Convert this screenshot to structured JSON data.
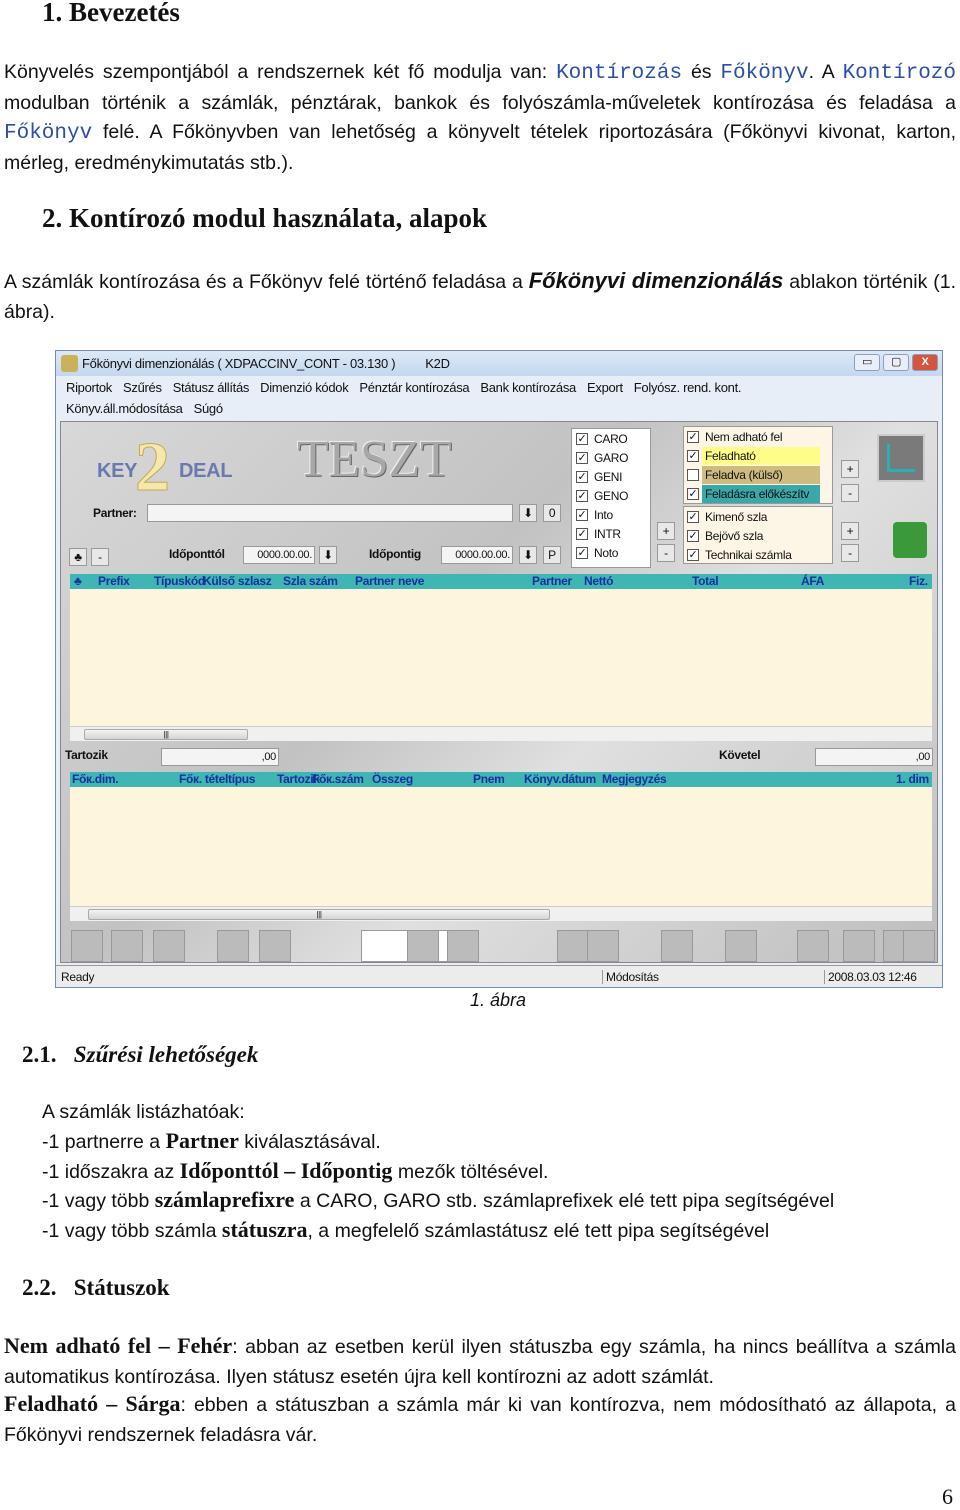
{
  "h1": "1.  Bevezetés",
  "p1": [
    "Könyvelés szempontjából a rendszernek két fő modulja van: ",
    "Kontírozás",
    " és ",
    "Főkönyv",
    ". A ",
    "Kontírozó",
    " modulban történik a számlák, pénztárak, bankok és folyószámla-műveletek kontírozása és feladása a ",
    "Főkönyv",
    " felé. A Főkönyvben van lehetőség a könyvelt tételek riportozására (Főkönyvi kivonat, karton, mérleg, eredménykimutatás stb.)."
  ],
  "h2": "2.  Kontírozó modul használata, alapok",
  "p2": [
    "A számlák kontírozása és a Főkönyv felé történő feladása a ",
    "Főkönyvi dimenzionálás",
    " ablakon történik (1. ábra)."
  ],
  "app": {
    "title": "Főkönyvi dimenzionálás ( XDPACCINV_CONT - 03.130 )",
    "title_suffix": "K2D",
    "window_buttons": [
      "▭",
      "▢",
      "X"
    ],
    "menu1": [
      "Riportok",
      "Szűrés",
      "Státusz állítás",
      "Dimenzió kódok",
      "Pénztár kontírozása",
      "Bank kontírozása",
      "Export",
      "Folyósz. rend. kont."
    ],
    "menu2": [
      "Könyv.áll.módosítása",
      "Súgó"
    ],
    "logo": "KEY2DEAL",
    "banner": "TESZT",
    "partner_label": "Partner:",
    "partner_value": "",
    "zero_btn": "0",
    "from_label": "Időponttól",
    "from_value": "0000.00.00.",
    "to_label": "Időpontig",
    "to_value": "0000.00.00.",
    "p_btn": "P",
    "prefixes": [
      {
        "label": "CARO",
        "checked": true
      },
      {
        "label": "GARO",
        "checked": true
      },
      {
        "label": "GENI",
        "checked": true
      },
      {
        "label": "GENO",
        "checked": true
      },
      {
        "label": "Into",
        "checked": true
      },
      {
        "label": "INTR",
        "checked": true
      },
      {
        "label": "Noto",
        "checked": true
      }
    ],
    "statuses": [
      {
        "label": "Nem adható fel",
        "checked": true,
        "color": "#fdf6e6"
      },
      {
        "label": "Feladható",
        "checked": true,
        "color": "#fdfd88"
      },
      {
        "label": "Feladva (külső)",
        "checked": false,
        "color": "#cdbb80"
      },
      {
        "label": "Feladásra előkészítv",
        "checked": true,
        "color": "#3aa8a8"
      }
    ],
    "types": [
      {
        "label": "Kimenő szla",
        "checked": true
      },
      {
        "label": "Bejövő szla",
        "checked": true
      },
      {
        "label": "Technikai számla",
        "checked": true
      }
    ],
    "grid1_cols": [
      "♣",
      "Prefix",
      "Típuskód",
      "Külső szlasz",
      "Szla szám",
      "Partner neve",
      "Partner",
      "Nettó",
      "Total",
      "ÁFA",
      "Fiz."
    ],
    "tartozik_label": "Tartozik",
    "tartozik_value": ",00",
    "kovetel_label": "Követel",
    "kovetel_value": ",00",
    "grid2_cols": [
      "Főк.dim.",
      "Főк. tételtípus",
      "Tartozik",
      "Főк.szám",
      "Összeg",
      "Pnem",
      "Könyv.dátum",
      "Megjegyzés",
      "1. dim"
    ],
    "status": {
      "left": "Ready",
      "mid": "Módosítás",
      "right": "2008.03.03 12:46"
    },
    "colors": {
      "grid_header": "#3fb6b4",
      "grid_body": "#fdf6dc",
      "header_text": "#1a2fa0"
    }
  },
  "caption": "1. ábra",
  "h21": [
    "2.1.",
    "Szűrési lehetőségek"
  ],
  "list": [
    [
      "A számlák listázhatóak:"
    ],
    [
      "-1 partnerre a ",
      "Partner",
      " kiválasztásával."
    ],
    [
      "-1 időszakra az ",
      "Időponttól – Időpontig",
      " mezők töltésével."
    ],
    [
      "-1 vagy több ",
      "számlaprefixre",
      " a CARO, GARO stb. számlaprefixek elé tett pipa segítségével"
    ],
    [
      "-1 vagy több számla ",
      "státuszra",
      ", a megfelelő számlastátusz elé tett pipa segítségével"
    ]
  ],
  "h22": [
    "2.2.",
    "Státuszok"
  ],
  "p3": [
    "Nem adható fel – Fehér",
    ": abban az esetben kerül ilyen státuszba egy számla, ha nincs beállítva a számla automatikus kontírozása. Ilyen státusz esetén újra kell kontírozni az adott számlát."
  ],
  "p4": [
    "Feladható – Sárga",
    ": ebben a státuszban a számla már ki van kontírozva, nem módosítható az állapota, a Főkönyvi rendszernek feladásra vár."
  ],
  "page_number": "6"
}
